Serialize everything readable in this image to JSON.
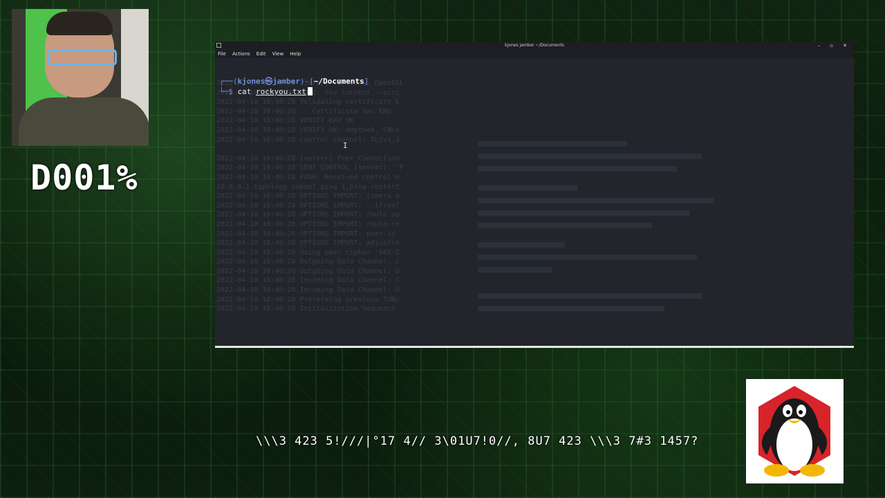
{
  "overlay": {
    "progress_code": "D001%",
    "subtitle": "\\\\\\3 423 5!///|°17 4// 3\\01U7!0//, 8U7 423 \\\\\\3 7#3 1457?"
  },
  "window": {
    "title": "kjones  jamber  ~/Documents",
    "controls": "– ▫ ✕",
    "menu": [
      "File",
      "Actions",
      "Edit",
      "View",
      "Help"
    ]
  },
  "terminal": {
    "prompt_open": "┌──(",
    "user": "kjones㉿jamber",
    "prompt_mid": ")-[",
    "path": "~/Documents",
    "prompt_close": "]",
    "prompt_symbol": "└─$ ",
    "command": "cat ",
    "argument": "rockyou.txt",
    "ghost_lines": [
      "2022-04-10 10:40:28 library versions: OpenSSL",
      "2022-04-10 10:40:28 NOTE: the current --scri",
      "2022-04-10 10:40:28 Validating certificate k",
      "2022-04-10 10:40:28 -- Certificate has EKU",
      "2022-04-10 10:40:28 VERIFY EKU OK",
      "2022-04-10 10:40:28 VERIFY OK: depth=0, CN=s",
      "2022-04-10 10:40:28 Control Channel: TLSv1.3",
      "",
      "2022-04-10 10:40:28 [server] Peer Connection",
      "2022-04-10 10:40:28 SENT CONTROL [server]: 'P",
      "2022-04-10 10:40:28 PUSH: Received control m",
      "10.8.0.1,topology subnet,ping 1,ping-restart",
      "2022-04-10 10:40:28 OPTIONS IMPORT: timers a",
      "2022-04-10 10:40:28 OPTIONS IMPORT: --ifconf",
      "2022-04-10 10:40:28 OPTIONS IMPORT: route op",
      "2022-04-10 10:40:28 OPTIONS IMPORT: route-re",
      "2022-04-10 10:40:28 OPTIONS IMPORT: peer-id",
      "2022-04-10 10:40:28 OPTIONS IMPORT: adjustin",
      "2022-04-10 10:40:28 Using peer cipher 'AES-2",
      "2022-04-10 10:40:28 Outgoing Data Channel: C",
      "2022-04-10 10:40:28 Outgoing Data Channel: U",
      "2022-04-10 10:40:28 Incoming Data Channel: C",
      "2022-04-10 10:40:28 Incoming Data Channel: U",
      "2022-04-10 10:40:28 Preserving previous TUN/",
      "2022-04-10 10:40:28 Initialization Sequence"
    ]
  },
  "colors": {
    "terminal_bg": "#22252c",
    "prompt_blue": "#6c8fd8",
    "background_green": "#0c1a0d"
  },
  "icons": [
    "terminal-app-icon",
    "tux-penguin-icon",
    "text-cursor-icon"
  ]
}
